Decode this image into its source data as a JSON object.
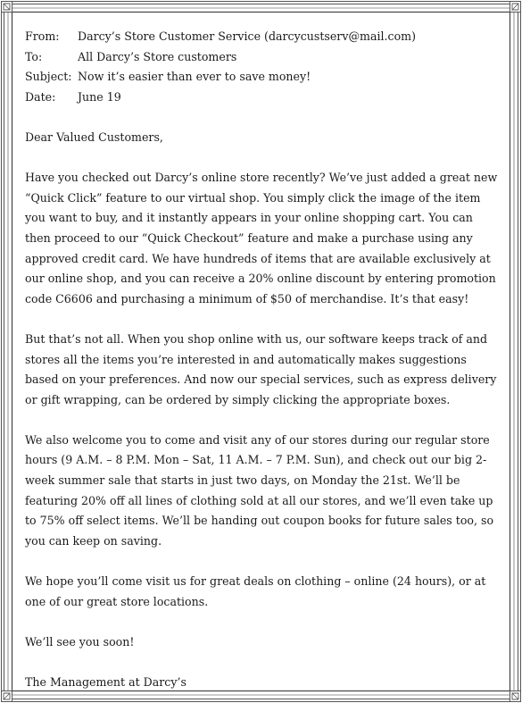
{
  "email": {
    "header": {
      "from_label": "From:",
      "from_value": "Darcy’s Store Customer Service (darcycustserv@mail.com)",
      "to_label": "To:",
      "to_value": "All Darcy’s Store customers",
      "subject_label": "Subject:",
      "subject_value": "Now it’s easier than ever to save money!",
      "date_label": "Date:",
      "date_value": "June 19"
    },
    "greeting": "Dear Valued Customers,",
    "paragraphs": [
      "Have you checked out Darcy’s online store recently? We’ve just added a great new “Quick Click” feature to our virtual shop. You simply click the image of the item you want to buy, and it instantly appears in your online shopping cart. You can then proceed to our “Quick Checkout” feature and make a purchase using any approved credit card. We have hundreds of items that are available exclusively at our online shop, and you can receive a 20% online discount by entering promotion code C6606 and purchasing a minimum of $50 of merchandise. It’s that easy!",
      "But that’s not all. When you shop online with us, our software keeps track of and stores all the items you’re interested in and automatically makes suggestions based on your preferences. And now our special services, such as express delivery or gift wrapping, can be ordered by simply clicking the appropriate boxes.",
      "We also welcome you to come and visit any of our stores during our regular store hours (9 A.M. – 8 P.M. Mon – Sat, 11 A.M. – 7 P.M. Sun), and check out our big 2-week summer sale that starts in just two days, on Monday the 21st. We’ll be featuring 20% off all lines of clothing sold at all our stores, and we’ll even take up to 75% off select items. We’ll be handing out coupon books for future sales too, so you can keep on saving.",
      "We hope you’ll come visit us for great deals on clothing – online (24 hours), or at one of our great store locations."
    ],
    "closing": "We’ll see you soon!",
    "signature": "The Management at Darcy’s"
  }
}
